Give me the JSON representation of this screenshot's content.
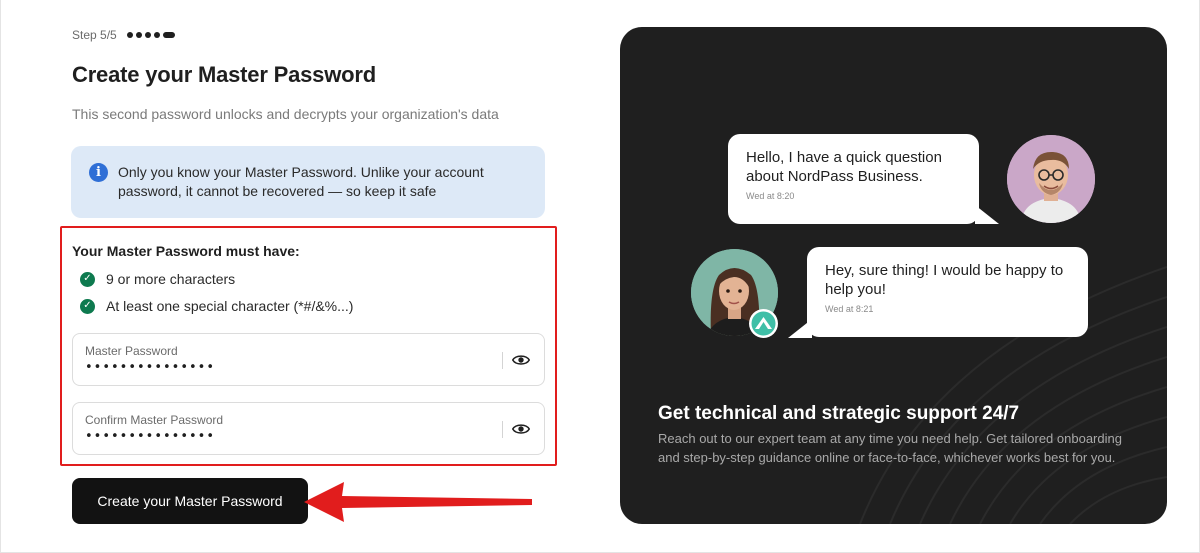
{
  "step": {
    "label": "Step 5/5",
    "total": 5,
    "current": 5
  },
  "form": {
    "title": "Create your Master Password",
    "subtitle": "This second password unlocks and decrypts your organization's data",
    "info": "Only you know your Master Password. Unlike your account password, it cannot be recovered — so keep it safe",
    "requirements_title": "Your Master Password must have:",
    "requirements": [
      {
        "label": "9 or more characters",
        "met": true
      },
      {
        "label": "At least one special character (*#/&%...)",
        "met": true
      }
    ],
    "fields": [
      {
        "label": "Master Password",
        "value": "•••••••••••••••"
      },
      {
        "label": "Confirm Master Password",
        "value": "•••••••••••••••"
      }
    ],
    "submit_label": "Create your Master Password"
  },
  "promo": {
    "messages": [
      {
        "text": "Hello, I have a quick question about NordPass Business.",
        "time": "Wed at 8:20"
      },
      {
        "text": "Hey, sure thing! I would be happy to help you!",
        "time": "Wed at 8:21"
      }
    ],
    "title": "Get technical and strategic support 24/7",
    "body": "Reach out to our expert team at any time you need help. Get tailored onboarding and step-by-step guidance online or face-to-face, whichever works best for you."
  },
  "colors": {
    "accent_blue": "#2f6fd6",
    "check_green": "#0e7a4f",
    "highlight_red": "#e11d1d",
    "panel_dark": "#1f1f1f",
    "button_dark": "#121212"
  },
  "icons": {
    "info": "info-icon",
    "check": "check-icon",
    "eye": "eye-icon",
    "support_logo": "mountain-logo-icon"
  }
}
